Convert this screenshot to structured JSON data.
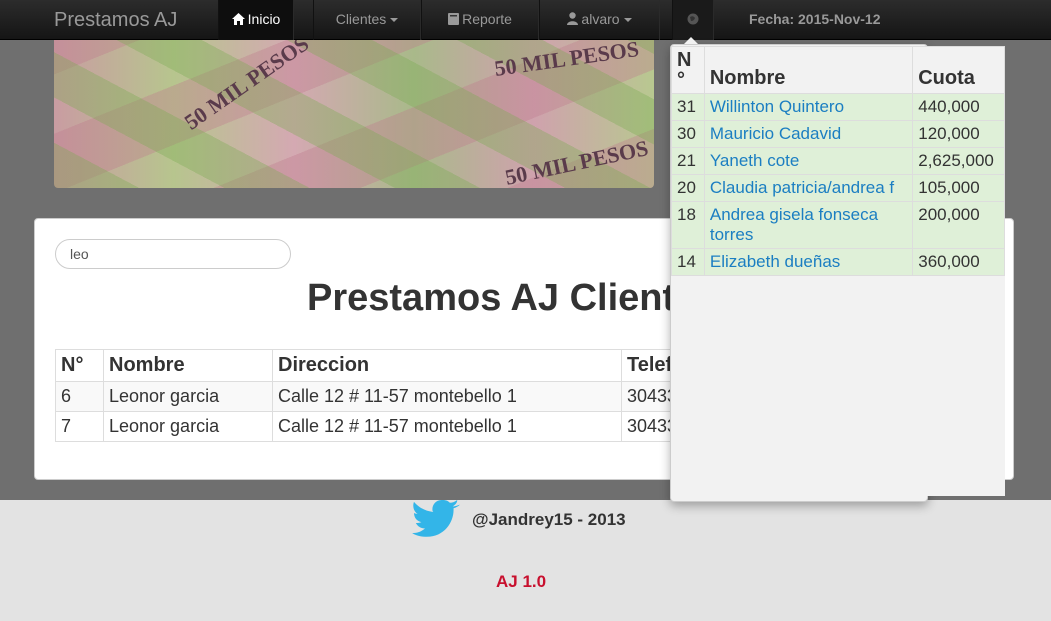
{
  "navbar": {
    "brand": "Prestamos AJ",
    "inicio": "Inicio",
    "clientes": "Clientes",
    "reporte": "Reporte",
    "user": "alvaro",
    "fecha": "Fecha: 2015-Nov-12"
  },
  "banner": {
    "notes": [
      "50 MIL PESOS",
      "50 MIL PESOS",
      "50 MIL PESOS"
    ]
  },
  "search": {
    "value": "leo"
  },
  "main": {
    "title": "Prestamos AJ Clientes",
    "headers": [
      "N°",
      "Nombre",
      "Direccion",
      "Telef"
    ],
    "rows": [
      {
        "n": "6",
        "nombre": "Leonor garcia",
        "direccion": "Calle 12 # 11-57 montebello 1",
        "telefono": "30433"
      },
      {
        "n": "7",
        "nombre": "Leonor garcia",
        "direccion": "Calle 12 # 11-57 montebello 1",
        "telefono": "30433"
      }
    ]
  },
  "dropdown": {
    "headers": [
      "N °",
      "Nombre",
      "Cuota"
    ],
    "rows": [
      {
        "n": "31",
        "nombre": "Willinton Quintero",
        "cuota": "440,000"
      },
      {
        "n": "30",
        "nombre": "Mauricio Cadavid",
        "cuota": "120,000"
      },
      {
        "n": "21",
        "nombre": "Yaneth cote",
        "cuota": "2,625,000"
      },
      {
        "n": "20",
        "nombre": "Claudia patricia/andrea f",
        "cuota": "105,000"
      },
      {
        "n": "18",
        "nombre": "Andrea gisela fonseca torres",
        "cuota": "200,000"
      },
      {
        "n": "14",
        "nombre": "Elizabeth dueñas",
        "cuota": "360,000"
      }
    ]
  },
  "footer": {
    "handle": "@Jandrey15 - 2013",
    "version": "AJ 1.0"
  },
  "colors": {
    "navbar": "#1b1b1b",
    "link": "#1b7ec2",
    "row_highlight": "#dff0d8",
    "version": "#c8102e"
  }
}
